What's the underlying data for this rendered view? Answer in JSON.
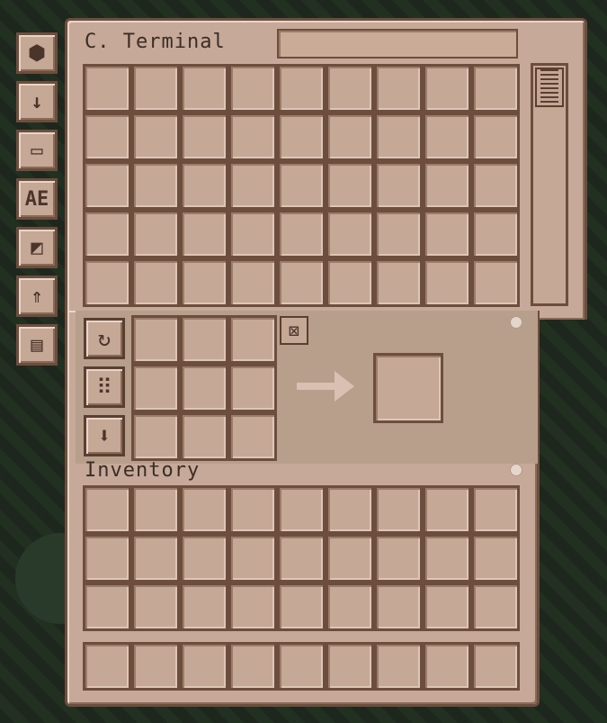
{
  "terminal": {
    "title": "C. Terminal",
    "search_value": "",
    "network_rows": 5,
    "network_cols": 9,
    "crafting_rows": 3,
    "crafting_cols": 3,
    "inventory_rows": 3,
    "inventory_cols": 9,
    "hotbar_cols": 9
  },
  "inventory": {
    "title": "Inventory"
  },
  "side_buttons": [
    {
      "name": "sort-by-icon",
      "glyph": "⬢"
    },
    {
      "name": "sort-direction-icon",
      "glyph": "↓"
    },
    {
      "name": "view-mode-icon",
      "glyph": "▭"
    },
    {
      "name": "search-mode-icon",
      "glyph": "AE"
    },
    {
      "name": "terminal-style-icon",
      "glyph": "◩"
    },
    {
      "name": "pattern-upload-icon",
      "glyph": "⇑"
    },
    {
      "name": "craft-panel-icon",
      "glyph": "▤"
    }
  ],
  "crafting_tools": [
    {
      "name": "rotate-recipe-icon",
      "glyph": "↻"
    },
    {
      "name": "grid-toggle-icon",
      "glyph": "⠿"
    },
    {
      "name": "move-down-icon",
      "glyph": "⬇"
    }
  ],
  "clear_glyph": "⊠"
}
